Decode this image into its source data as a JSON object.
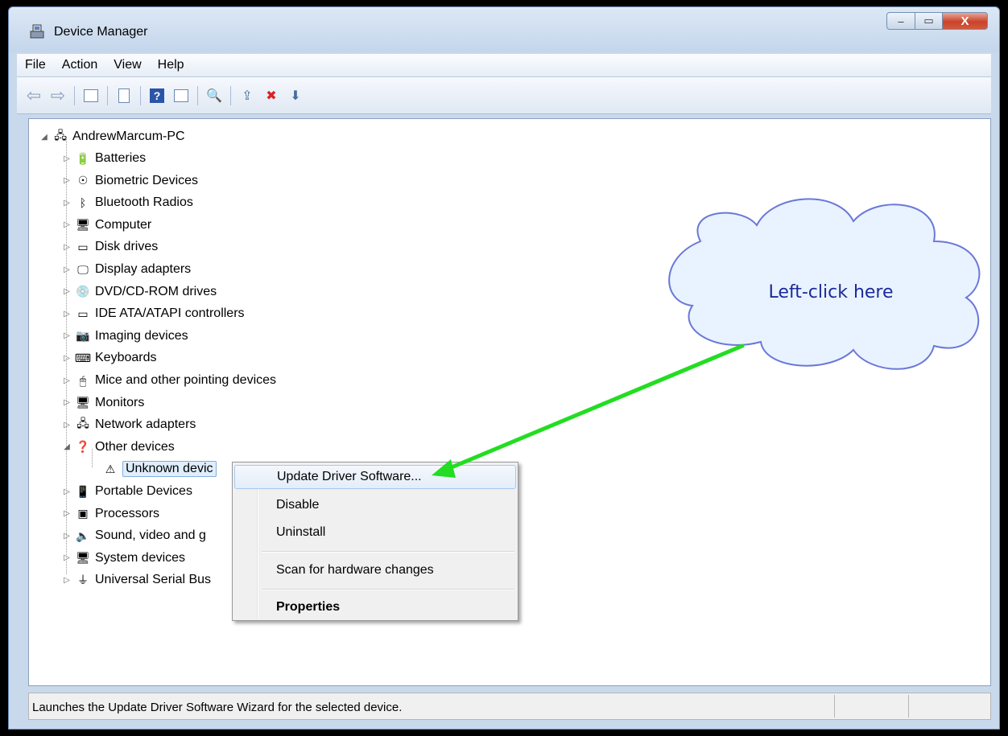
{
  "window": {
    "title": "Device Manager",
    "controls": {
      "minimize": "–",
      "maximize": "▭",
      "close": "X"
    }
  },
  "menu": [
    "File",
    "Action",
    "View",
    "Help"
  ],
  "tree": {
    "root": "AndrewMarcum-PC",
    "categories": [
      {
        "label": "Batteries",
        "icon": "battery-icon"
      },
      {
        "label": "Biometric Devices",
        "icon": "fingerprint-icon"
      },
      {
        "label": "Bluetooth Radios",
        "icon": "bluetooth-icon"
      },
      {
        "label": "Computer",
        "icon": "computer-icon"
      },
      {
        "label": "Disk drives",
        "icon": "disk-drive-icon"
      },
      {
        "label": "Display adapters",
        "icon": "display-adapter-icon"
      },
      {
        "label": "DVD/CD-ROM drives",
        "icon": "dvd-drive-icon"
      },
      {
        "label": "IDE ATA/ATAPI controllers",
        "icon": "ide-controller-icon"
      },
      {
        "label": "Imaging devices",
        "icon": "camera-icon"
      },
      {
        "label": "Keyboards",
        "icon": "keyboard-icon"
      },
      {
        "label": "Mice and other pointing devices",
        "icon": "mouse-icon"
      },
      {
        "label": "Monitors",
        "icon": "monitor-icon"
      },
      {
        "label": "Network adapters",
        "icon": "network-icon"
      },
      {
        "label": "Other devices",
        "icon": "unknown-device-icon"
      },
      {
        "label": "Unknown devic",
        "icon": "warning-device-icon"
      },
      {
        "label": "Portable Devices",
        "icon": "portable-device-icon"
      },
      {
        "label": "Processors",
        "icon": "processor-icon"
      },
      {
        "label": "Sound, video and g",
        "icon": "speaker-icon"
      },
      {
        "label": "System devices",
        "icon": "system-device-icon"
      },
      {
        "label": "Universal Serial Bus",
        "icon": "usb-icon"
      }
    ]
  },
  "context_menu": {
    "items": [
      {
        "label": "Update Driver Software...",
        "highlighted": true
      },
      {
        "label": "Disable"
      },
      {
        "label": "Uninstall"
      },
      {
        "label": "Scan for hardware changes"
      },
      {
        "label": "Properties",
        "bold": true
      }
    ]
  },
  "annotation": {
    "text": "Left-click here",
    "arrow_color": "#22dd22"
  },
  "status": {
    "text": "Launches the Update Driver Software Wizard for the selected device."
  }
}
